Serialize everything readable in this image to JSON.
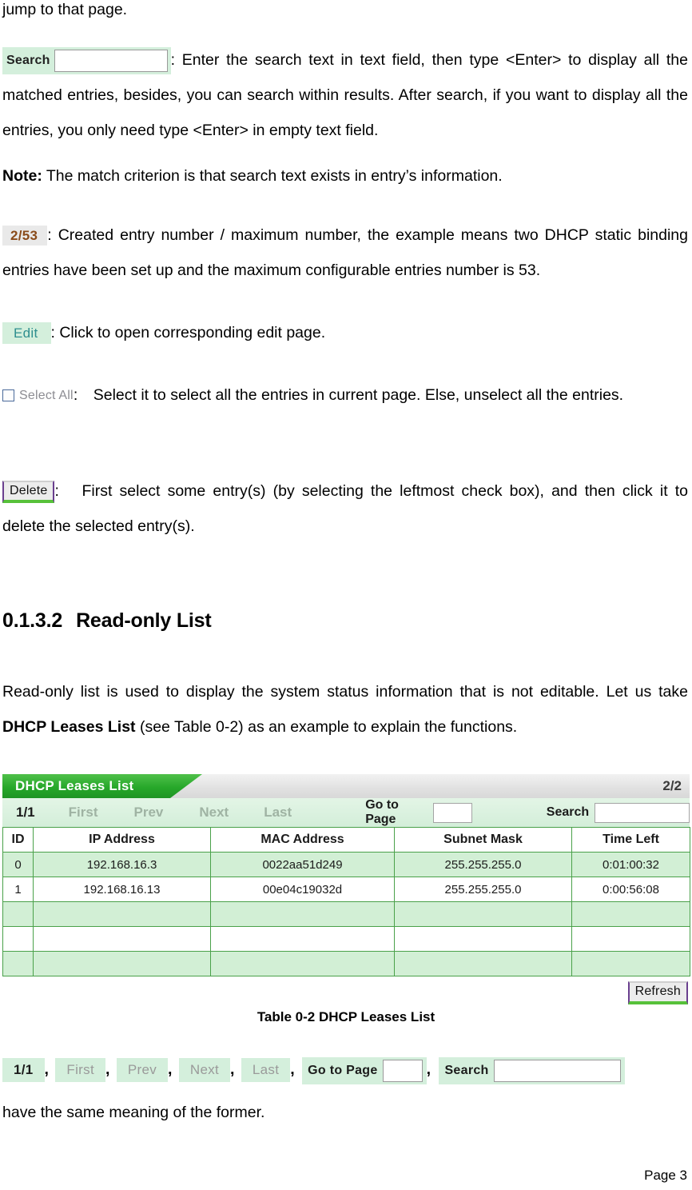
{
  "intro_line": "jump to that page.",
  "search_widget": {
    "label": "Search",
    "input_value": "",
    "description": ": Enter the search text in text field, then type <Enter> to display all the matched entries, besides, you can search within results. After search, if you want to display all the entries, you only need type <Enter> in empty text field."
  },
  "note": {
    "label": "Note:",
    "text": " The match criterion is that search text exists in entry’s information."
  },
  "counter_widget": {
    "value": "2/53",
    "description": ": Created entry number / maximum number, the example means two DHCP static binding entries have been set up and the maximum configurable entries number is 53."
  },
  "edit_widget": {
    "label": "Edit",
    "description": ": Click to open corresponding edit page."
  },
  "select_all_widget": {
    "label": "Select All",
    "description": ": Select it to select all the entries in current page. Else, unselect all the entries."
  },
  "delete_widget": {
    "label": "Delete",
    "description": ":  First select some entry(s) (by selecting the leftmost check box), and then click it to delete the selected entry(s)."
  },
  "heading": {
    "number": "0.1.3.2",
    "title": "Read-only List"
  },
  "body_paragraph": {
    "part1": "Read-only list is used to display the system status information that is not editable. Let us take ",
    "bold": "DHCP Leases List",
    "part2": " (see Table 0-2) as an example to explain the functions."
  },
  "screenshot": {
    "title": "DHCP Leases List",
    "page_indicator": "2/2",
    "toolbar": {
      "current_page": "1/1",
      "first": "First",
      "prev": "Prev",
      "next": "Next",
      "last": "Last",
      "go_to_page_label": "Go to Page",
      "go_to_page_value": "",
      "search_label": "Search",
      "search_value": ""
    },
    "columns": [
      "ID",
      "IP Address",
      "MAC Address",
      "Subnet Mask",
      "Time Left"
    ],
    "rows": [
      {
        "shade": "green",
        "cells": [
          "0",
          "192.168.16.3",
          "0022aa51d249",
          "255.255.255.0",
          "0:01:00:32"
        ]
      },
      {
        "shade": "white",
        "cells": [
          "1",
          "192.168.16.13",
          "00e04c19032d",
          "255.255.255.0",
          "0:00:56:08"
        ]
      },
      {
        "shade": "green",
        "cells": [
          "",
          "",
          "",
          "",
          ""
        ]
      },
      {
        "shade": "white",
        "cells": [
          "",
          "",
          "",
          "",
          ""
        ]
      },
      {
        "shade": "green",
        "cells": [
          "",
          "",
          "",
          "",
          ""
        ]
      }
    ],
    "refresh_label": "Refresh"
  },
  "table_caption": "Table 0-2 DHCP Leases List",
  "legend_row": {
    "current_page": "1/1",
    "first": "First",
    "prev": "Prev",
    "next": "Next",
    "last": "Last",
    "go_to_page_label": "Go to Page",
    "go_to_page_value": "",
    "search_label": "Search",
    "search_value": "",
    "separator": ","
  },
  "closing_line": "have the same meaning of the former.",
  "footer": "Page  3",
  "colors": {
    "chip_green": "#d4efdc",
    "tab_green": "#27a82a",
    "table_border_green": "#4aa14a",
    "row_green": "#d2efd5",
    "counter_text": "#8a4b1a",
    "edit_text": "#2f8f8f",
    "disabled_text": "#9fb3a3",
    "bevel_purple": "#6a3f8f",
    "bevel_green": "#57c13a"
  }
}
